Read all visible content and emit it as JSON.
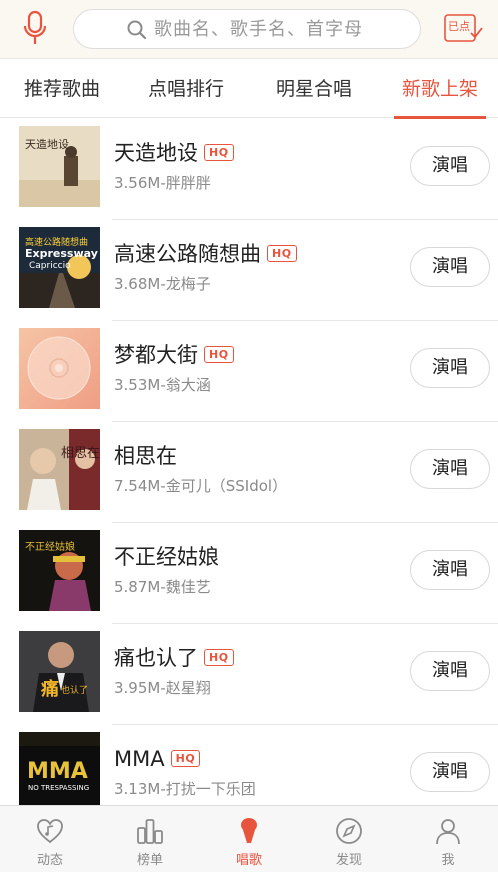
{
  "search": {
    "placeholder": "歌曲名、歌手名、首字母"
  },
  "played_button": {
    "label": "已点"
  },
  "tabs": [
    {
      "label": "推荐歌曲",
      "active": false
    },
    {
      "label": "点唱排行",
      "active": false
    },
    {
      "label": "明星合唱",
      "active": false
    },
    {
      "label": "新歌上架",
      "active": true
    }
  ],
  "songs": [
    {
      "title": "天造地设",
      "hq": "HQ",
      "meta": "3.56M-胖胖胖",
      "action": "演唱"
    },
    {
      "title": "高速公路随想曲",
      "hq": "HQ",
      "meta": "3.68M-龙梅子",
      "action": "演唱"
    },
    {
      "title": "梦都大街",
      "hq": "HQ",
      "meta": "3.53M-翁大涵",
      "action": "演唱"
    },
    {
      "title": "相思在",
      "hq": "",
      "meta": "7.54M-金可儿（SSIdol）",
      "action": "演唱"
    },
    {
      "title": "不正经姑娘",
      "hq": "",
      "meta": "5.87M-魏佳艺",
      "action": "演唱"
    },
    {
      "title": "痛也认了",
      "hq": "HQ",
      "meta": "3.95M-赵星翔",
      "action": "演唱"
    },
    {
      "title": "MMA",
      "hq": "HQ",
      "meta": "3.13M-打扰一下乐团",
      "action": "演唱"
    }
  ],
  "covers": {
    "cover1_text": "天造地设",
    "cover2_text": "Expressway",
    "cover2_text_b": "Capriccio",
    "cover2_cn": "高速公路随想曲",
    "cover4_text": "相思在",
    "cover5_text": "不正经姑娘",
    "cover6_text": "痛",
    "cover6_text_b": "也认了",
    "cover7_text": "MMA",
    "cover7_sub": "NO TRESPASSING"
  },
  "nav": [
    {
      "label": "动态",
      "icon": "heart-note-icon",
      "active": false
    },
    {
      "label": "榜单",
      "icon": "chart-bars-icon",
      "active": false
    },
    {
      "label": "唱歌",
      "icon": "microphone-icon",
      "active": true
    },
    {
      "label": "发现",
      "icon": "compass-icon",
      "active": false
    },
    {
      "label": "我",
      "icon": "person-icon",
      "active": false
    }
  ],
  "colors": {
    "accent": "#e8553f",
    "text": "#222222",
    "muted": "#8a8a8a"
  }
}
